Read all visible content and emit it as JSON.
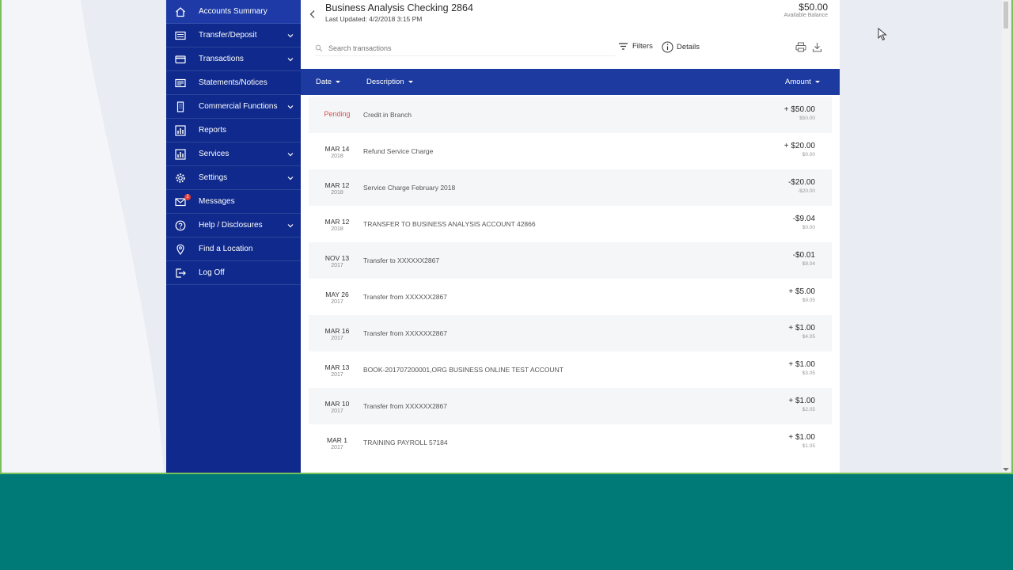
{
  "sidebar": {
    "items": [
      {
        "label": "Accounts Summary",
        "icon": "home-icon",
        "has_submenu": false
      },
      {
        "label": "Transfer/Deposit",
        "icon": "transfer-icon",
        "has_submenu": true
      },
      {
        "label": "Transactions",
        "icon": "card-icon",
        "has_submenu": true
      },
      {
        "label": "Statements/Notices",
        "icon": "statement-icon",
        "has_submenu": false
      },
      {
        "label": "Commercial Functions",
        "icon": "building-icon",
        "has_submenu": true
      },
      {
        "label": "Reports",
        "icon": "chart-icon",
        "has_submenu": false
      },
      {
        "label": "Services",
        "icon": "chart-icon",
        "has_submenu": true
      },
      {
        "label": "Settings",
        "icon": "gear-icon",
        "has_submenu": true
      },
      {
        "label": "Messages",
        "icon": "mail-icon",
        "has_submenu": false,
        "badge": "2"
      },
      {
        "label": "Help / Disclosures",
        "icon": "help-icon",
        "has_submenu": true
      },
      {
        "label": "Find a Location",
        "icon": "location-pin-icon",
        "has_submenu": false
      },
      {
        "label": "Log Off",
        "icon": "logout-icon",
        "has_submenu": false
      }
    ]
  },
  "account": {
    "title": "Business Analysis Checking  2864",
    "last_updated": "Last Updated: 4/2/2018 3:15 PM",
    "balance": "$50.00",
    "balance_label": "Available Balance"
  },
  "toolbar": {
    "search_placeholder": "Search transactions",
    "filters_label": "Filters",
    "details_label": "Details"
  },
  "table": {
    "headers": {
      "date": "Date",
      "description": "Description",
      "amount": "Amount"
    },
    "rows": [
      {
        "date": "Pending",
        "year": "",
        "pending": true,
        "description": "Credit in Branch",
        "amount": "+ $50.00",
        "balance": "$50.00"
      },
      {
        "date": "MAR 14",
        "year": "2018",
        "description": "Refund Service Charge",
        "amount": "+ $20.00",
        "balance": "$0.00"
      },
      {
        "date": "MAR 12",
        "year": "2018",
        "description": "Service Charge February 2018",
        "amount": "-$20.00",
        "balance": "-$20.00"
      },
      {
        "date": "MAR 12",
        "year": "2018",
        "description": "TRANSFER TO BUSINESS ANALYSIS ACCOUNT 42866",
        "amount": "-$9.04",
        "balance": "$0.00"
      },
      {
        "date": "NOV 13",
        "year": "2017",
        "description": "Transfer to XXXXXX2867",
        "amount": "-$0.01",
        "balance": "$9.04"
      },
      {
        "date": "MAY 26",
        "year": "2017",
        "description": "Transfer from XXXXXX2867",
        "amount": "+ $5.00",
        "balance": "$9.05"
      },
      {
        "date": "MAR 16",
        "year": "2017",
        "description": "Transfer from XXXXXX2867",
        "amount": "+ $1.00",
        "balance": "$4.05"
      },
      {
        "date": "MAR 13",
        "year": "2017",
        "description": "BOOK-201707200001,ORG BUSINESS ONLINE TEST ACCOUNT",
        "amount": "+ $1.00",
        "balance": "$3.05"
      },
      {
        "date": "MAR 10",
        "year": "2017",
        "description": "Transfer from XXXXXX2867",
        "amount": "+ $1.00",
        "balance": "$2.05"
      },
      {
        "date": "MAR 1",
        "year": "2017",
        "description": "TRAINING PAYROLL 57184",
        "amount": "+ $1.00",
        "balance": "$1.05"
      }
    ]
  },
  "colors": {
    "sidebar_bg": "#0f2a8c",
    "table_header_bg": "#1c3aa0",
    "pending_text": "#d9534f",
    "taskbar": "#007a77",
    "window_border": "#78c15a"
  }
}
